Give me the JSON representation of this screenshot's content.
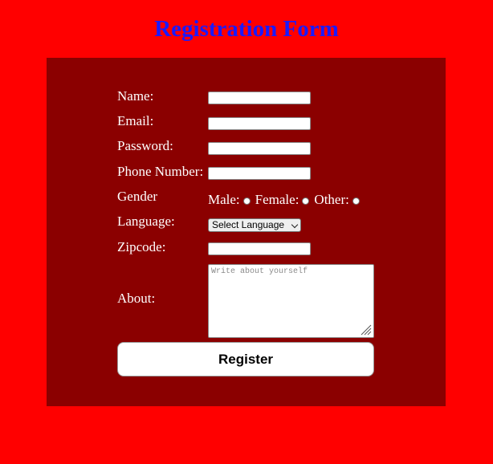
{
  "page": {
    "title": "Registration Form",
    "background_color": "#ff0000",
    "panel_color": "#8b0000",
    "title_color": "#1a1aff"
  },
  "form": {
    "name_label": "Name:",
    "name_value": "",
    "email_label": "Email:",
    "email_value": "",
    "password_label": "Password:",
    "password_value": "",
    "phone_label": "Phone Number:",
    "phone_value": "",
    "gender_label": "Gender",
    "gender_options": [
      "Male:",
      "Female:",
      "Other:"
    ],
    "gender_selected": "",
    "language_label": "Language:",
    "language_selected": "Select Language",
    "zipcode_label": "Zipcode:",
    "zipcode_value": "",
    "about_label": "About:",
    "about_placeholder": "Write about yourself",
    "about_value": "",
    "register_label": "Register"
  },
  "icons": {
    "select_arrow": "chevron-down-icon",
    "textarea_resize": "resize-grip-icon"
  }
}
